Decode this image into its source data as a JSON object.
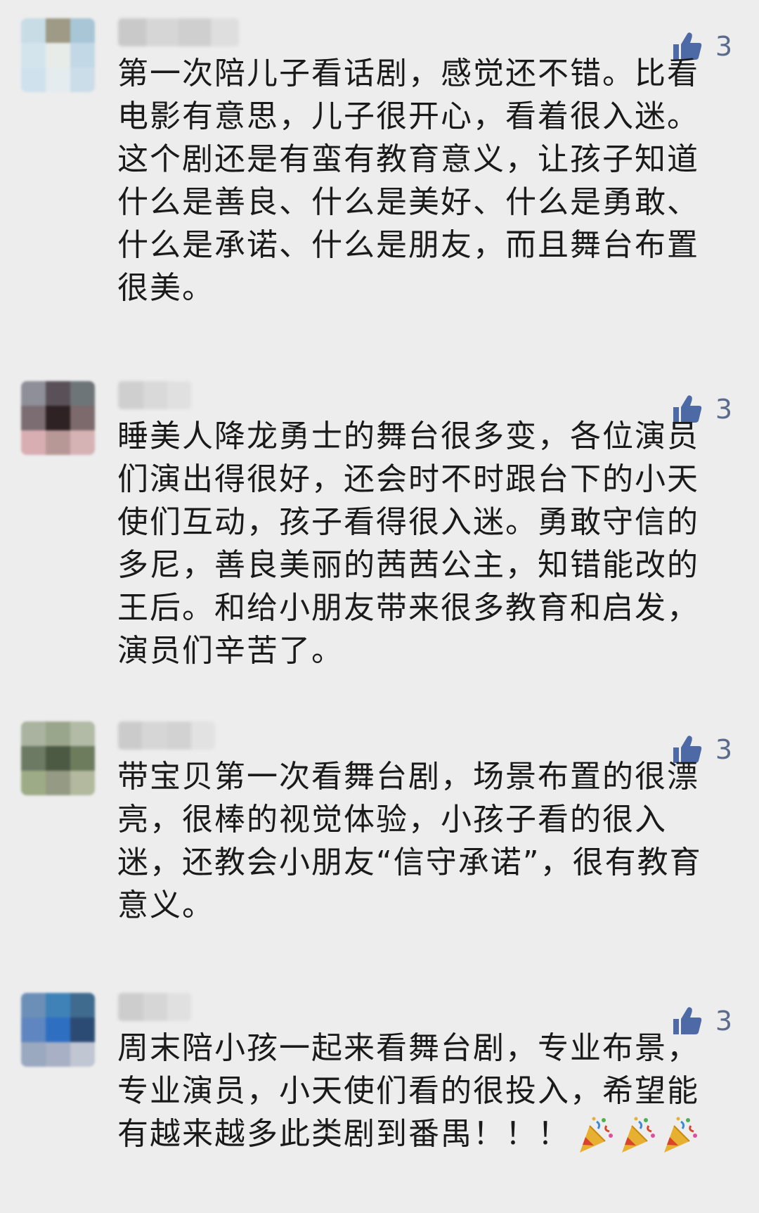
{
  "comments": [
    {
      "likes": "3",
      "text": "第一次陪儿子看话剧，感觉还不错。比看电影有意思，儿子很开心，看着很入迷。这个剧还是有蛮有教育意义，让孩子知道什么是善良、什么是美好、什么是勇敢、什么是承诺、什么是朋友，而且舞台布置很美。"
    },
    {
      "likes": "3",
      "text": "睡美人降龙勇士的舞台很多变，各位演员们演出得很好，还会时不时跟台下的小天使们互动，孩子看得很入迷。勇敢守信的多尼，善良美丽的茜茜公主，知错能改的王后。和给小朋友带来很多教育和启发，演员们辛苦了。"
    },
    {
      "likes": "3",
      "text": "带宝贝第一次看舞台剧，场景布置的很漂亮，很棒的视觉体验，小孩子看的很入迷，还教会小朋友“信守承诺”，很有教育意义。"
    },
    {
      "likes": "3",
      "text": "周末陪小孩一起来看舞台剧，专业布景，专业演员，小天使们看的很投入，希望能有越来越多此类剧到番禺！！！",
      "emoji": [
        "party-popper-icon",
        "party-popper-icon",
        "party-popper-icon"
      ]
    }
  ],
  "colors": {
    "background": "#ededed",
    "like_icon": "#4e6aa6",
    "like_count": "#5a6b8c",
    "text": "#1a1a1a"
  }
}
